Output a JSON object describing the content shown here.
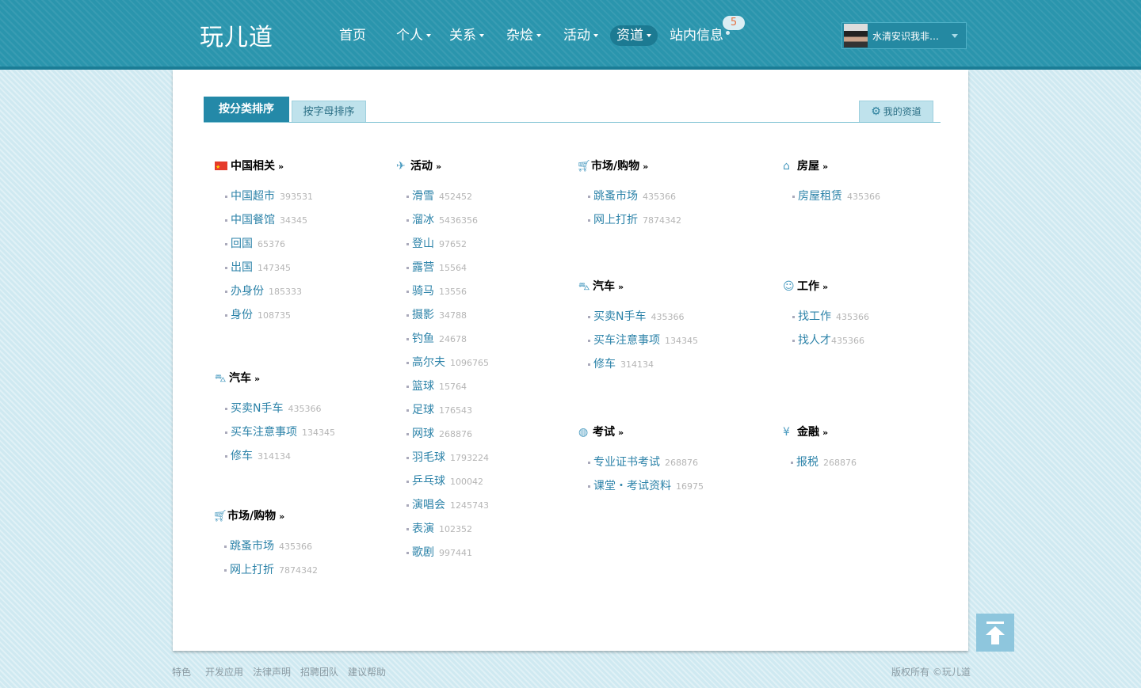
{
  "header": {
    "logo": "玩儿道",
    "nav": [
      {
        "label": "首页"
      },
      {
        "label": "个人"
      },
      {
        "label": "关系"
      },
      {
        "label": "杂烩"
      },
      {
        "label": "活动"
      },
      {
        "label": "资道"
      },
      {
        "label": "站内信息"
      }
    ],
    "message_count": "5",
    "user_name": "水清安识我非…"
  },
  "tabs": {
    "by_category": "按分类排序",
    "by_letter": "按字母排序",
    "mine": "我的资道"
  },
  "columns": [
    {
      "categories": [
        {
          "title": "中国相关",
          "more": "»",
          "icon": "china-flag-icon",
          "items": [
            {
              "name": "中国超市",
              "count": "393531"
            },
            {
              "name": "中国餐馆",
              "count": "34345"
            },
            {
              "name": "回国",
              "count": "65376"
            },
            {
              "name": "出国",
              "count": "147345"
            },
            {
              "name": "办身份",
              "count": "185333"
            },
            {
              "name": "身份",
              "count": "108735"
            }
          ]
        },
        {
          "title": "汽车",
          "more": "»",
          "icon": "car-icon",
          "items": [
            {
              "name": "买卖N手车",
              "count": "435366"
            },
            {
              "name": "买车注意事项",
              "count": "134345"
            },
            {
              "name": "修车",
              "count": "314134"
            }
          ]
        },
        {
          "title": "市场/购物",
          "more": "»",
          "icon": "shopping-cart-icon",
          "items": [
            {
              "name": "跳蚤市场",
              "count": "435366"
            },
            {
              "name": "网上打折",
              "count": "7874342"
            }
          ]
        }
      ]
    },
    {
      "categories": [
        {
          "title": "活动",
          "more": "»",
          "icon": "airplane-icon",
          "items": [
            {
              "name": "滑雪",
              "count": "452452"
            },
            {
              "name": "溜冰",
              "count": "5436356"
            },
            {
              "name": "登山",
              "count": "97652"
            },
            {
              "name": "露营",
              "count": "15564"
            },
            {
              "name": "骑马",
              "count": "13556"
            },
            {
              "name": "摄影",
              "count": "34788"
            },
            {
              "name": "钓鱼",
              "count": "24678"
            },
            {
              "name": "高尔夫",
              "count": "1096765"
            },
            {
              "name": "篮球",
              "count": "15764"
            },
            {
              "name": "足球",
              "count": "176543"
            },
            {
              "name": "网球",
              "count": "268876"
            },
            {
              "name": "羽毛球",
              "count": "1793224"
            },
            {
              "name": "乒乓球",
              "count": "100042"
            },
            {
              "name": "演唱会",
              "count": "1245743"
            },
            {
              "name": "表演",
              "count": "102352"
            },
            {
              "name": "歌剧",
              "count": "997441"
            }
          ]
        }
      ]
    },
    {
      "categories": [
        {
          "title": "市场/购物",
          "more": "»",
          "icon": "shopping-cart-icon",
          "items": [
            {
              "name": "跳蚤市场",
              "count": "435366"
            },
            {
              "name": "网上打折",
              "count": "7874342"
            }
          ]
        },
        {
          "title": "汽车",
          "more": "»",
          "icon": "car-icon",
          "items": [
            {
              "name": "买卖N手车",
              "count": "435366"
            },
            {
              "name": "买车注意事项",
              "count": "134345"
            },
            {
              "name": "修车",
              "count": "314134"
            }
          ]
        },
        {
          "title": "考试",
          "more": "»",
          "icon": "globe-icon",
          "items": [
            {
              "name": "专业证书考试",
              "count": "268876"
            },
            {
              "name": "课堂・考试资料",
              "count": "16975"
            }
          ]
        }
      ]
    },
    {
      "categories": [
        {
          "title": "房屋",
          "more": "»",
          "icon": "house-icon",
          "items": [
            {
              "name": "房屋租赁",
              "count": "435366"
            }
          ]
        },
        {
          "title": "工作",
          "more": "»",
          "icon": "people-icon",
          "items": [
            {
              "name": "找工作",
              "count": "435366"
            },
            {
              "name": "找人才",
              "count": "435366"
            }
          ]
        },
        {
          "title": "金融",
          "more": "»",
          "icon": "yen-icon",
          "items": [
            {
              "name": "报税",
              "count": "268876"
            }
          ]
        }
      ]
    }
  ],
  "footer": {
    "links": [
      "特色",
      "开发应用",
      "法律声明",
      "招聘团队",
      "建议帮助"
    ],
    "copyright": "版权所有 ©玩儿道"
  }
}
